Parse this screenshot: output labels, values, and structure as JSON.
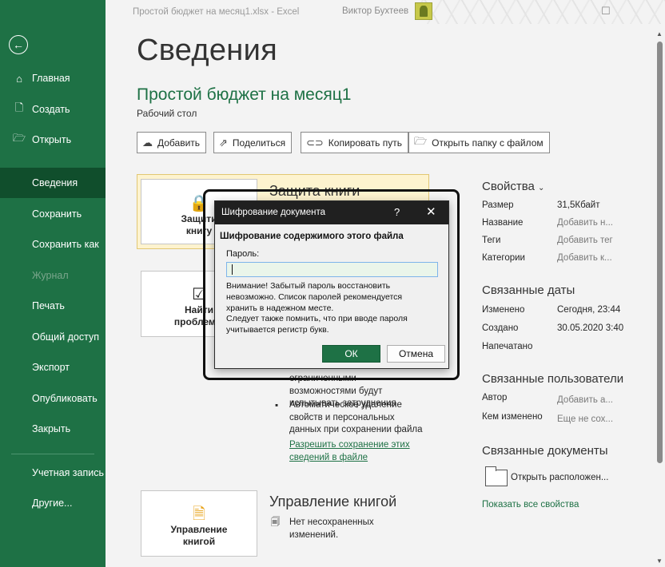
{
  "titlebar": {
    "document": "Простой бюджет на месяц1.xlsx  -  Excel",
    "user": "Виктор Бухтеев"
  },
  "sidebar": {
    "back_icon": "arrow-left-circle-icon",
    "items": [
      {
        "label": "Главная",
        "icon": "home-icon"
      },
      {
        "label": "Создать",
        "icon": "new-document-icon"
      },
      {
        "label": "Открыть",
        "icon": "folder-open-icon"
      },
      {
        "label": "Сведения",
        "active": true
      },
      {
        "label": "Сохранить"
      },
      {
        "label": "Сохранить как"
      },
      {
        "label": "Журнал",
        "disabled": true
      },
      {
        "label": "Печать"
      },
      {
        "label": "Общий доступ"
      },
      {
        "label": "Экспорт"
      },
      {
        "label": "Опубликовать"
      },
      {
        "label": "Закрыть"
      },
      {
        "label": "Учетная запись"
      },
      {
        "label": "Другие..."
      }
    ]
  },
  "main": {
    "page_title": "Сведения",
    "file_name": "Простой бюджет на месяц1",
    "file_location": "Рабочий стол",
    "toolbar": {
      "upload": "Добавить",
      "share": "Поделиться",
      "copy_path": "Копировать путь",
      "open_folder": "Открыть папку с файлом"
    },
    "protect": {
      "card_label_line1": "Защити",
      "card_label_line2": "книгу",
      "title": "Защита книги"
    },
    "inspect": {
      "card_label_line1": "Найти",
      "card_label_line2": "проблемы",
      "bullet_cut1": "ограниченными",
      "bullet_cut2": "возможностями будут",
      "bullet_cut3": "испытывать затруднения",
      "bullet2_line1": "Автоматическое удаление",
      "bullet2_line2": "свойств и персональных",
      "bullet2_line3": "данных при сохранении файла",
      "link_line1": "Разрешить сохранение этих",
      "link_line2": "сведений в файле"
    },
    "manage": {
      "card_label_line1": "Управление",
      "card_label_line2": "книгой",
      "title": "Управление книгой",
      "text_line1": "Нет несохраненных",
      "text_line2": "изменений."
    }
  },
  "properties": {
    "heading": "Свойства",
    "rows": [
      {
        "label": "Размер",
        "value": "31,5Кбайт",
        "muted": false
      },
      {
        "label": "Название",
        "value": "Добавить н...",
        "muted": true
      },
      {
        "label": "Теги",
        "value": "Добавить тег",
        "muted": true
      },
      {
        "label": "Категории",
        "value": "Добавить к...",
        "muted": true
      }
    ],
    "dates_heading": "Связанные даты",
    "dates": [
      {
        "label": "Изменено",
        "value": "Сегодня, 23:44"
      },
      {
        "label": "Создано",
        "value": "30.05.2020 3:40"
      },
      {
        "label": "Напечатано",
        "value": ""
      }
    ],
    "users_heading": "Связанные пользователи",
    "users": [
      {
        "label": "Автор",
        "value": "Добавить а..."
      },
      {
        "label": "Кем изменено",
        "value": "Еще не сох..."
      }
    ],
    "docs_heading": "Связанные документы",
    "open_location": "Открыть расположен...",
    "show_all": "Показать все свойства"
  },
  "dialog": {
    "title": "Шифрование документа",
    "help": "?",
    "close": "✕",
    "heading": "Шифрование содержимого этого файла",
    "password_label": "Пароль:",
    "password_value": "",
    "warning_line1": "Внимание! Забытый пароль восстановить",
    "warning_line2": "невозможно. Список паролей рекомендуется",
    "warning_line3": "хранить в надежном месте.",
    "warning_line4": "Следует также помнить, что при вводе пароля",
    "warning_line5": "учитывается регистр букв.",
    "ok": "ОК",
    "cancel": "Отмена"
  }
}
